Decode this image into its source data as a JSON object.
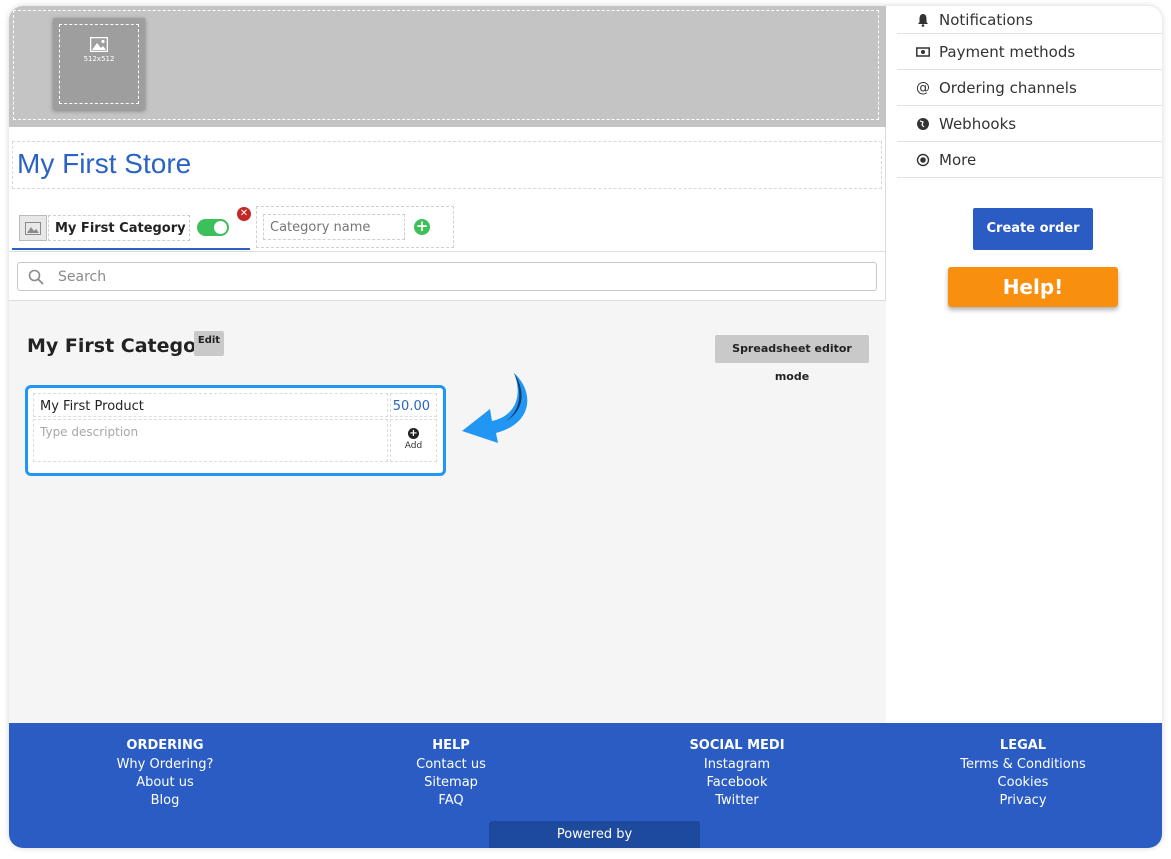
{
  "banner": {
    "logo_placeholder_size": "512x512",
    "store_title": "My First Store"
  },
  "category_tabs": {
    "active_tab_label": "My First Category",
    "active_enabled": true,
    "new_category_placeholder": "Category name"
  },
  "search": {
    "placeholder": "Search"
  },
  "category_section": {
    "heading": "My First Category",
    "edit_label": "Edit",
    "spreadsheet_label": "Spreadsheet editor mode"
  },
  "product": {
    "name": "My First Product",
    "price": "50.00",
    "description_placeholder": "Type description",
    "add_label": "Add"
  },
  "sidebar": {
    "items": [
      {
        "label": "Notifications",
        "icon": "bell-icon"
      },
      {
        "label": "Payment methods",
        "icon": "banknote-icon"
      },
      {
        "label": "Ordering channels",
        "icon": "at-sign-icon"
      },
      {
        "label": "Webhooks",
        "icon": "globe-icon"
      },
      {
        "label": "More",
        "icon": "radio-dot-icon"
      }
    ],
    "create_order_label": "Create order",
    "help_label": "Help!"
  },
  "footer": {
    "columns": [
      {
        "title": "ORDERING",
        "links": [
          "Why Ordering?",
          "About us",
          "Blog"
        ]
      },
      {
        "title": "HELP",
        "links": [
          "Contact us",
          "Sitemap",
          "FAQ"
        ]
      },
      {
        "title": "SOCIAL MEDI",
        "links": [
          "Instagram",
          "Facebook",
          "Twitter"
        ]
      },
      {
        "title": "LEGAL",
        "links": [
          "Terms & Conditions",
          "Cookies",
          "Privacy"
        ]
      }
    ],
    "powered_by": "Powered by"
  },
  "colors": {
    "brand_blue": "#2a5cc4",
    "help_orange": "#f98f0e",
    "highlight_blue": "#2196f3",
    "toggle_green": "#3cc15a"
  }
}
